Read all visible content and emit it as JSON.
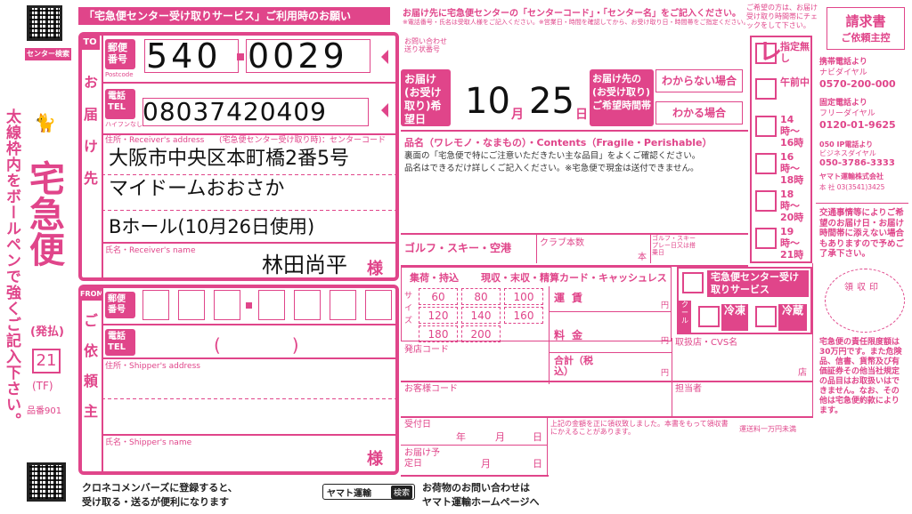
{
  "header": {
    "top_notice": "「宅急便センター受け取りサービス」ご利用時のお願い",
    "center_notice": "お届け先に宅急便センターの「センターコード」・「センター名」をご記入ください。",
    "center_notice_sub": "※電話番号・氏名は受取人様をご記入ください。※営業日・時間を確認してから、お受け取り日・時間帯をご指定ください。",
    "right_note": "ご希望の方は、お届け受け取り時間帯にチェックをして下さい。",
    "invoice_title": "請求書",
    "invoice_sub": "ご依頼主控"
  },
  "left": {
    "center_search": "センター検索",
    "vertical_instruction": "太線枠内をボールペンで強くご記入下さい。",
    "brand": "宅急便",
    "payment": "(発払)",
    "form_no": "21",
    "tf": "(TF)",
    "item_no": "品番901"
  },
  "to": {
    "label": "TO",
    "vertical": "お届け先",
    "postal_label": "郵便番号",
    "postal_sub": "Postcode",
    "postal_first": "540",
    "postal_second": "0029",
    "tel_label": "電話TEL",
    "tel_sub": "ハイフンなし",
    "tel": "08037420409",
    "address_label": "住所・Receiver's address",
    "address_hint": "(宅急便センター受け取り時)：センターコード",
    "address_line1": "大阪市中央区本町橋2番5号",
    "address_line2": "マイドームおおさか",
    "address_line3": "Bホール(10月26日使用)",
    "name_label": "氏名・Receiver's name",
    "name": "林田尚平",
    "sama": "様"
  },
  "inquiry": {
    "label": "お問い合わせ送り状番号"
  },
  "delivery_date": {
    "label": "お届け(お受け取り)希望日",
    "month": "10",
    "month_unit": "月",
    "day": "25",
    "day_unit": "日",
    "time_label": "お届け先の(お受け取り)ご希望時間帯",
    "unknown": "わからない場合",
    "known": "わかる場合"
  },
  "time_slots": [
    {
      "label": "指定無し",
      "checked": true
    },
    {
      "label": "午前中",
      "checked": true
    },
    {
      "label": "14時〜16時",
      "checked": true
    },
    {
      "label": "16時〜18時",
      "checked": true
    },
    {
      "label": "18時〜20時",
      "checked": true
    },
    {
      "label": "19時〜21時",
      "checked": true
    }
  ],
  "goods": {
    "label": "品名（ワレモノ・なまもの）・Contents（Fragile・Perishable）",
    "note1": "裏面の「宅急便で特にご注意いただきたい主な品目」をよくご確認ください。",
    "note2": "品名はできるだけ詳しくご記入ください。※宅急便で現金は送付できません。",
    "golf": "ゴルフ・スキー・空港",
    "club": "クラブ本数",
    "hon": "本",
    "golf_date": "ゴルフ・スキープレー日又は搭乗日"
  },
  "collection": {
    "header": "集荷・持込",
    "header2": "現収・末収・精算カード・キャッシュレス",
    "sizes": [
      "60",
      "80",
      "100",
      "120",
      "140",
      "160",
      "180",
      "200"
    ],
    "size_label": "サイズ",
    "fare": "運賃",
    "fee": "料金",
    "total": "合計（税込）",
    "yen": "円",
    "shop_code": "発店コード",
    "customer_code": "お客様コード"
  },
  "center_service": {
    "label": "宅急便センター受け取りサービス",
    "cool": "クール",
    "frozen": "冷凍",
    "chilled": "冷蔵"
  },
  "from": {
    "label": "FROM",
    "vertical": "ご依頼主",
    "postal_label": "郵便番号",
    "tel_label": "電話TEL",
    "paren": "(　　　　)",
    "address_label": "住所・Shipper's address",
    "name_label": "氏名・Shipper's name",
    "sama": "様"
  },
  "right_info": {
    "mobile_label": "携帯電話より",
    "navi": "ナビダイヤル",
    "navi_no": "0570-200-000",
    "fixed_label": "固定電話より",
    "free": "フリーダイヤル",
    "free_no": "0120-01-9625",
    "ip_label": "050 IP電話より",
    "biz": "ビジネスダイヤル",
    "biz_no": "050-3786-3333",
    "company": "ヤマト運輸株式会社",
    "hq": "本 社 03(3541)3425",
    "traffic_note": "交通事情等によりご希望のお届け日・お届け時間帯に添えない場合もありますので予めご了承下さい。",
    "stamp": "領収印",
    "liability": "宅急便の責任限度額は30万円です。また危険品、信書、貨幣及び有価証券その他当社規定の品目はお取扱いはできません。なお、その他は宅急便約款によります。"
  },
  "bottom": {
    "receipt_date": "受付日",
    "y": "年",
    "m": "月",
    "d": "日",
    "planned": "お届け予定日",
    "received_note": "上記の金額を正に領収致しました。本書をもって領収書にかえることがあります。",
    "fare_limit": "運送料一万円未満",
    "handling_shop": "取扱店・CVS名",
    "shop": "店",
    "staff": "担当者",
    "kuroneko": "クロネコメンバーズに登録すると、",
    "kuroneko2": "受け取る・送るが便利になります",
    "search_word": "ヤマト運輸",
    "search_btn": "検索",
    "inquiry_hp": "お荷物のお問い合わせは",
    "inquiry_hp2": "ヤマト運輸ホームページへ"
  }
}
